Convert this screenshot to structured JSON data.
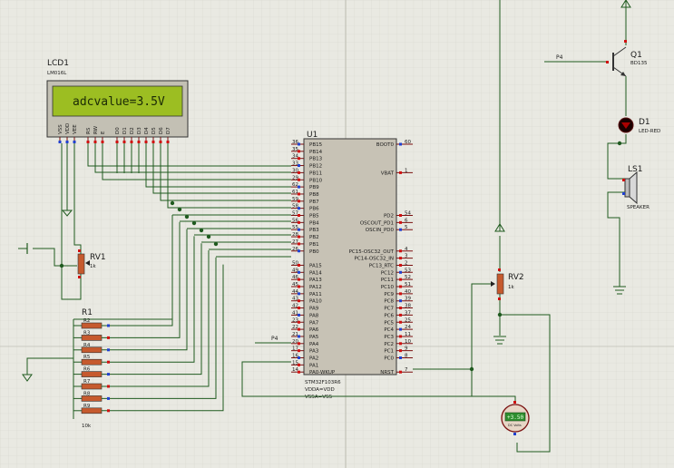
{
  "lcd": {
    "ref": "LCD1",
    "part": "LM016L",
    "display_text": "adcvalue=3.5V",
    "pins": [
      "VSS",
      "VDD",
      "VEE",
      "RS",
      "RW",
      "E",
      "D0",
      "D1",
      "D2",
      "D3",
      "D4",
      "D5",
      "D6",
      "D7"
    ]
  },
  "mcu": {
    "ref": "U1",
    "part": "STM32F103R6",
    "power_lines": [
      "VDDA=VDD",
      "VSSA=VSS"
    ],
    "left_pins": [
      {
        "num": "36",
        "name": "PB15"
      },
      {
        "num": "35",
        "name": "PB14"
      },
      {
        "num": "34",
        "name": "PB13"
      },
      {
        "num": "33",
        "name": "PB12"
      },
      {
        "num": "30",
        "name": "PB11"
      },
      {
        "num": "29",
        "name": "PB10"
      },
      {
        "num": "62",
        "name": "PB9"
      },
      {
        "num": "61",
        "name": "PB8"
      },
      {
        "num": "59",
        "name": "PB7"
      },
      {
        "num": "58",
        "name": "PB6"
      },
      {
        "num": "57",
        "name": "PB5"
      },
      {
        "num": "56",
        "name": "PB4"
      },
      {
        "num": "55",
        "name": "PB3"
      },
      {
        "num": "28",
        "name": "PB2"
      },
      {
        "num": "27",
        "name": "PB1"
      },
      {
        "num": "26",
        "name": "PB0"
      },
      {
        "num": "",
        "name": ""
      },
      {
        "num": "50",
        "name": "PA15"
      },
      {
        "num": "49",
        "name": "PA14"
      },
      {
        "num": "46",
        "name": "PA13"
      },
      {
        "num": "45",
        "name": "PA12"
      },
      {
        "num": "44",
        "name": "PA11"
      },
      {
        "num": "43",
        "name": "PA10"
      },
      {
        "num": "42",
        "name": "PA9"
      },
      {
        "num": "41",
        "name": "PA8"
      },
      {
        "num": "23",
        "name": "PA7"
      },
      {
        "num": "22",
        "name": "PA6"
      },
      {
        "num": "21",
        "name": "PA5"
      },
      {
        "num": "20",
        "name": "PA4"
      },
      {
        "num": "17",
        "name": "PA3"
      },
      {
        "num": "16",
        "name": "PA2"
      },
      {
        "num": "15",
        "name": "PA1"
      },
      {
        "num": "14",
        "name": "PA0-WKUP"
      }
    ],
    "right_pins": [
      {
        "num": "60",
        "name": "BOOT0",
        "row": 0
      },
      {
        "num": "1",
        "name": "VBAT",
        "row": 4
      },
      {
        "num": "54",
        "name": "PD2",
        "row": 10
      },
      {
        "num": "6",
        "name": "OSCOUT_PD1",
        "row": 11
      },
      {
        "num": "5",
        "name": "OSCIN_PD0",
        "row": 12
      },
      {
        "num": "4",
        "name": "PC15-OSC32_OUT",
        "row": 15
      },
      {
        "num": "3",
        "name": "PC14-OSC32_IN",
        "row": 16
      },
      {
        "num": "2",
        "name": "PC13_RTC",
        "row": 17
      },
      {
        "num": "53",
        "name": "PC12",
        "row": 18
      },
      {
        "num": "52",
        "name": "PC11",
        "row": 19
      },
      {
        "num": "51",
        "name": "PC10",
        "row": 20
      },
      {
        "num": "40",
        "name": "PC9",
        "row": 21
      },
      {
        "num": "39",
        "name": "PC8",
        "row": 22
      },
      {
        "num": "38",
        "name": "PC7",
        "row": 23
      },
      {
        "num": "37",
        "name": "PC6",
        "row": 24
      },
      {
        "num": "25",
        "name": "PC5",
        "row": 25
      },
      {
        "num": "24",
        "name": "PC4",
        "row": 26
      },
      {
        "num": "11",
        "name": "PC3",
        "row": 27
      },
      {
        "num": "10",
        "name": "PC2",
        "row": 28
      },
      {
        "num": "9",
        "name": "PC1",
        "row": 29
      },
      {
        "num": "8",
        "name": "PC0",
        "row": 30
      },
      {
        "num": "7",
        "name": "NRST",
        "row": 32
      }
    ]
  },
  "rv1": {
    "ref": "RV1",
    "value": "1k"
  },
  "rv2": {
    "ref": "RV2",
    "value": "1k"
  },
  "r1": {
    "ref": "R1",
    "labels": [
      "R2",
      "R3",
      "R4",
      "R5",
      "R6",
      "R7",
      "R8",
      "R9"
    ],
    "value": "10k"
  },
  "q1": {
    "ref": "Q1",
    "part": "BD135"
  },
  "d1": {
    "ref": "D1",
    "part": "LED-RED"
  },
  "ls1": {
    "ref": "LS1",
    "part": "SPEAKER"
  },
  "voltmeter": {
    "reading": "+3.50",
    "unit": "DC Volts"
  },
  "nets": {
    "p4_transistor": "P4",
    "p4_mcu": "P4"
  },
  "colors": {
    "wire": "#1f5a1f",
    "lcd_screen": "#9cbe22",
    "lcd_text": "#1b2a06",
    "mcu_body": "#c7c2b5",
    "pin_red": "#d01010",
    "pin_blue": "#2040d0",
    "grid_minor": "#d6d6cd",
    "grid_major": "#bdbdb2"
  }
}
